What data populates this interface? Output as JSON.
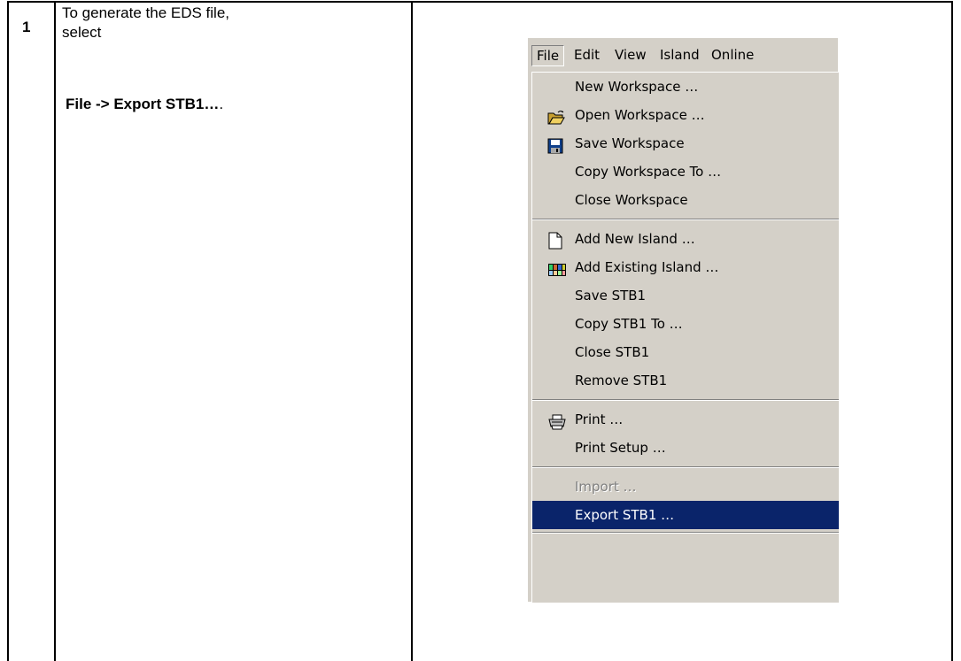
{
  "step": {
    "number": "1",
    "instruction_line1": "To generate the EDS file,",
    "instruction_line2": "select",
    "path_text": "File -> Export STB1…",
    "path_suffix": "."
  },
  "menubar": {
    "items": [
      "File",
      "Edit",
      "View",
      "Island",
      "Online"
    ],
    "open_item": "File"
  },
  "file_menu": {
    "groups": [
      [
        {
          "label": "New Workspace …",
          "icon": null
        },
        {
          "label": "Open Workspace …",
          "icon": "open-folder-icon"
        },
        {
          "label": "Save Workspace",
          "icon": "floppy-disk-icon"
        },
        {
          "label": "Copy Workspace To …",
          "icon": null
        },
        {
          "label": "Close Workspace",
          "icon": null
        }
      ],
      [
        {
          "label": "Add New Island …",
          "icon": "blank-document-icon"
        },
        {
          "label": "Add Existing Island …",
          "icon": "island-modules-icon"
        },
        {
          "label": "Save STB1",
          "icon": null
        },
        {
          "label": "Copy STB1 To …",
          "icon": null
        },
        {
          "label": "Close STB1",
          "icon": null
        },
        {
          "label": "Remove STB1",
          "icon": null
        }
      ],
      [
        {
          "label": "Print …",
          "icon": "printer-icon"
        },
        {
          "label": "Print Setup …",
          "icon": null
        }
      ],
      [
        {
          "label": "Import …",
          "icon": null,
          "disabled": true
        },
        {
          "label": "Export STB1 …",
          "icon": null,
          "selected": true
        }
      ]
    ]
  },
  "colors": {
    "menu_bg": "#d4d0c8",
    "highlight_bg": "#0a246a",
    "highlight_text": "#ffffff",
    "disabled_text": "#808080"
  }
}
